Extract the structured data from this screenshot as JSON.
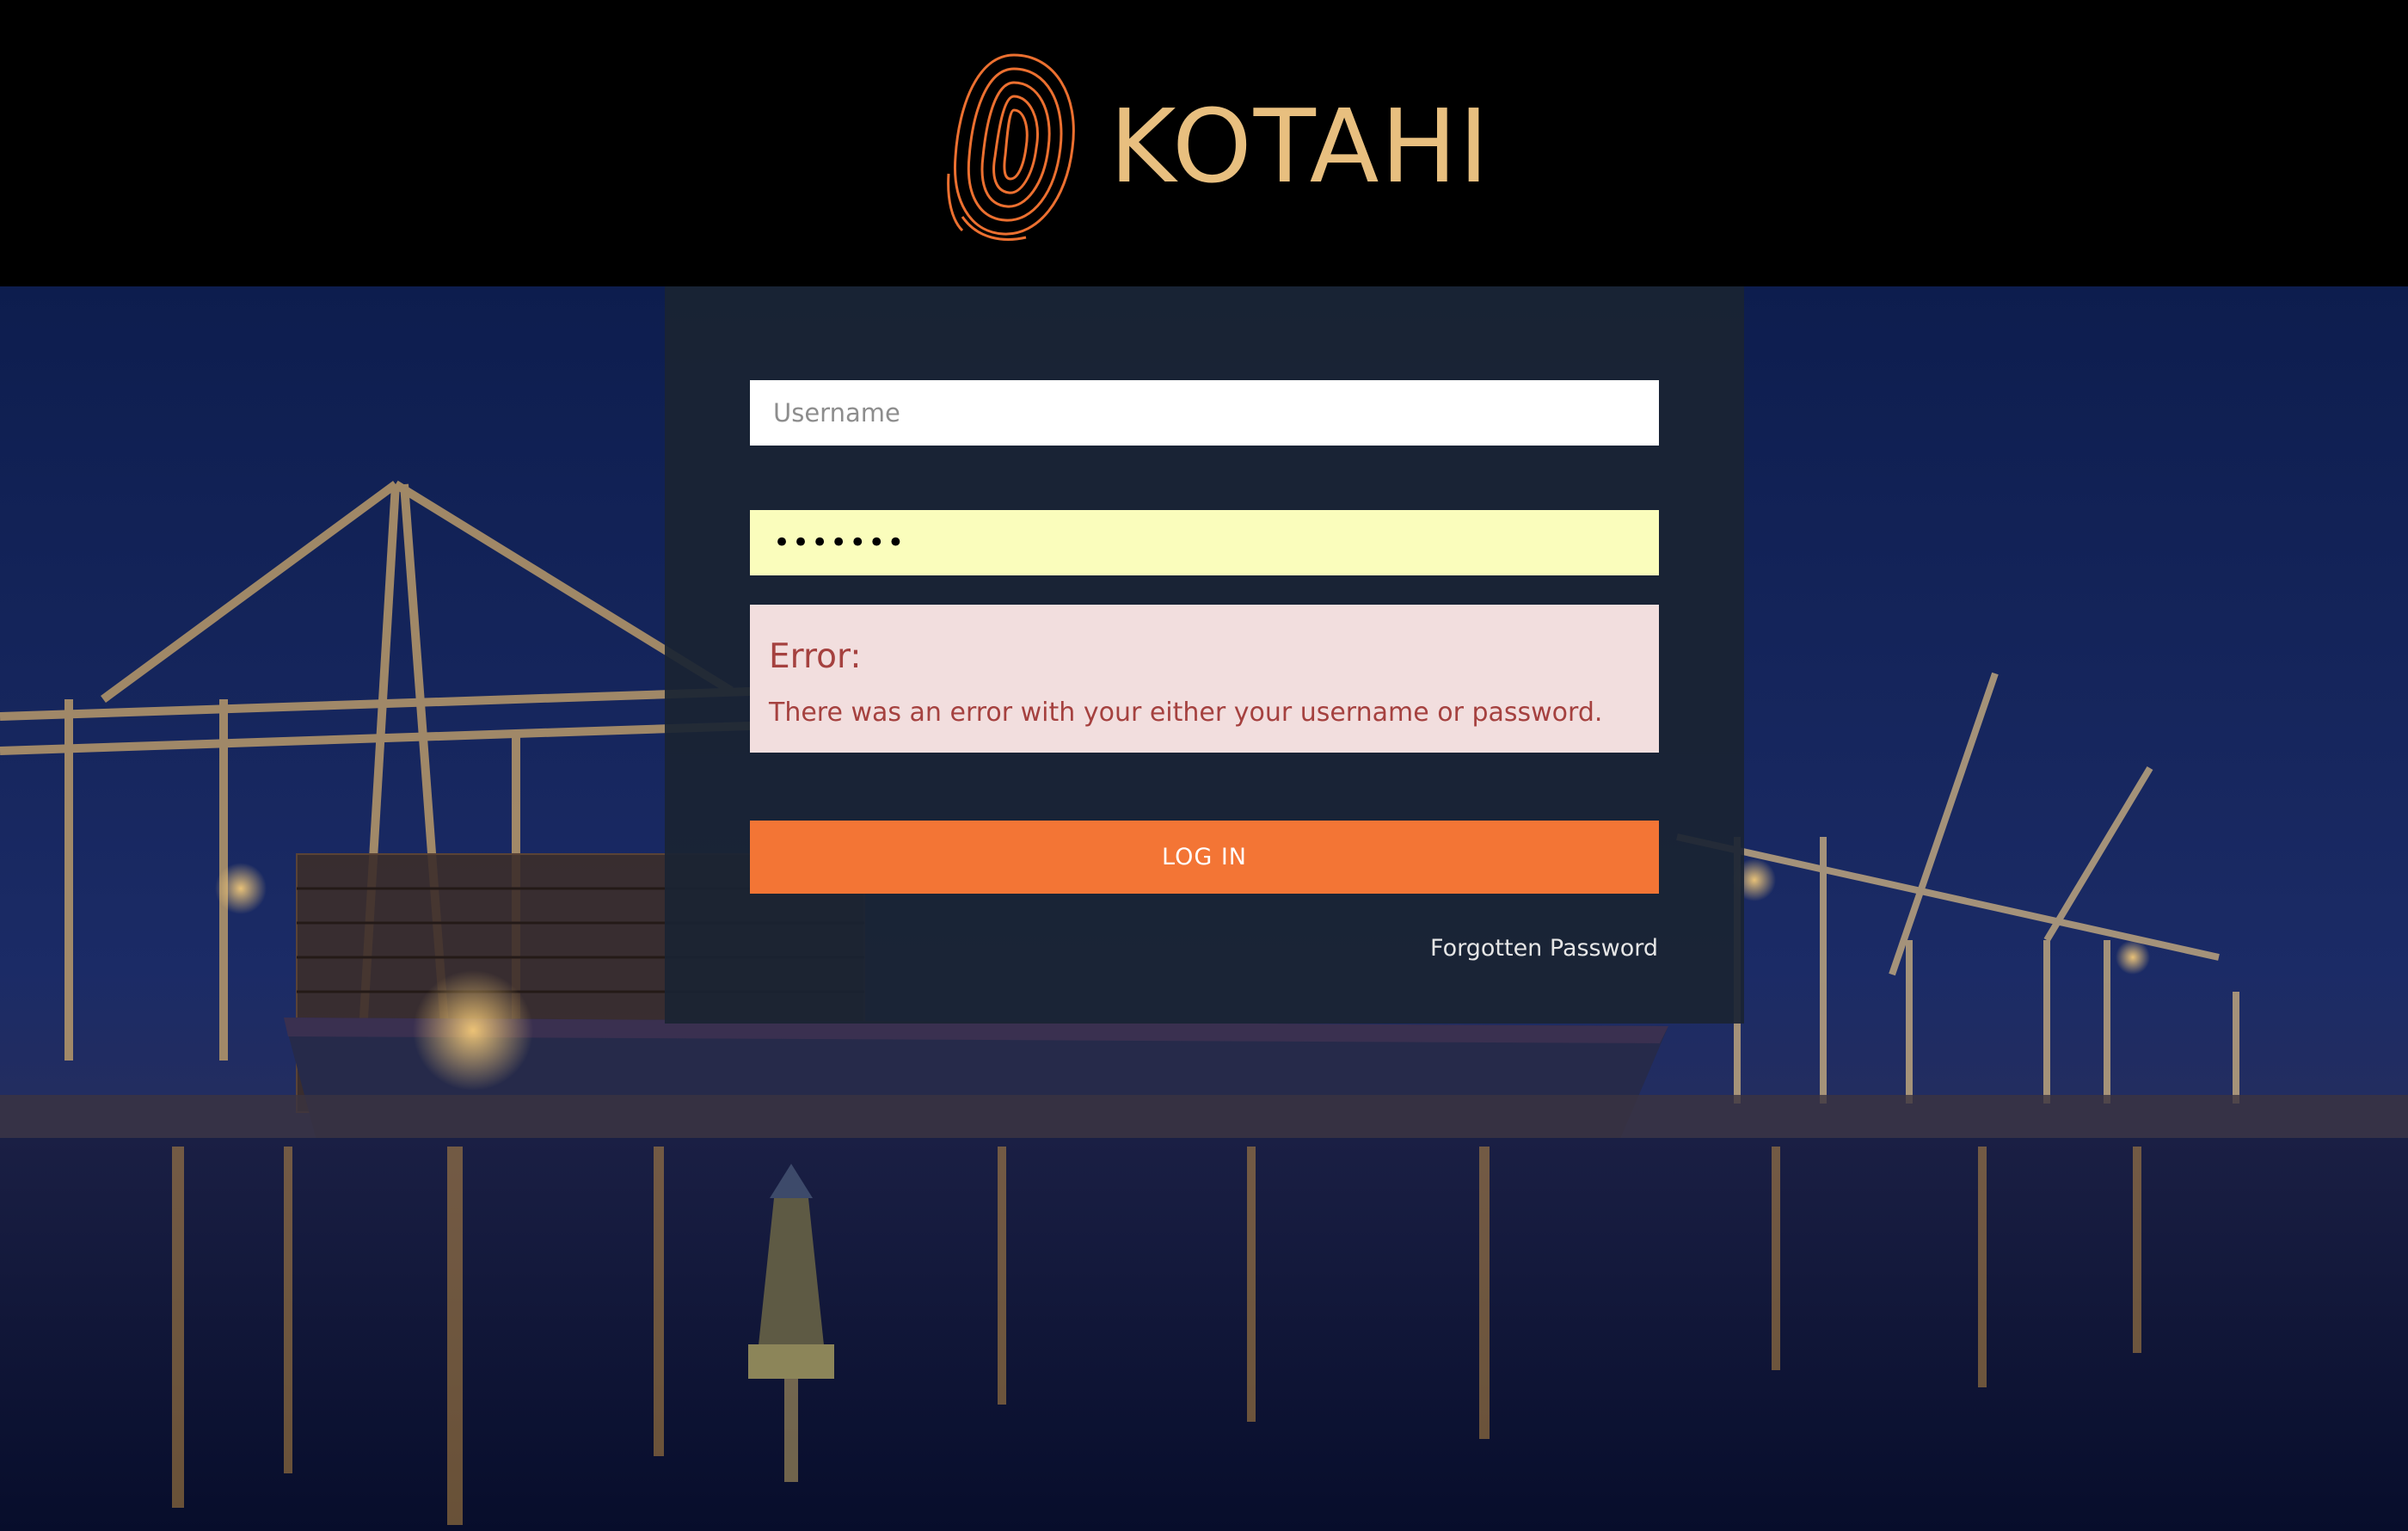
{
  "brand": {
    "name": "KOTAHI",
    "logo_icon": "fingerprint-icon",
    "text_color": "#e8bf7f",
    "icon_color": "#ec7030"
  },
  "login": {
    "username_placeholder": "Username",
    "password_value": "•••••••",
    "error_title": "Error:",
    "error_message": "There was an error with your either your username or password.",
    "login_label": "LOG IN",
    "forgot_label": "Forgotten Password"
  },
  "colors": {
    "header_bg": "#000000",
    "panel_bg": "#1a2333",
    "button_bg": "#f37535",
    "error_bg": "#f2dede",
    "error_text": "#a5413f",
    "password_bg": "#fafdbc"
  }
}
